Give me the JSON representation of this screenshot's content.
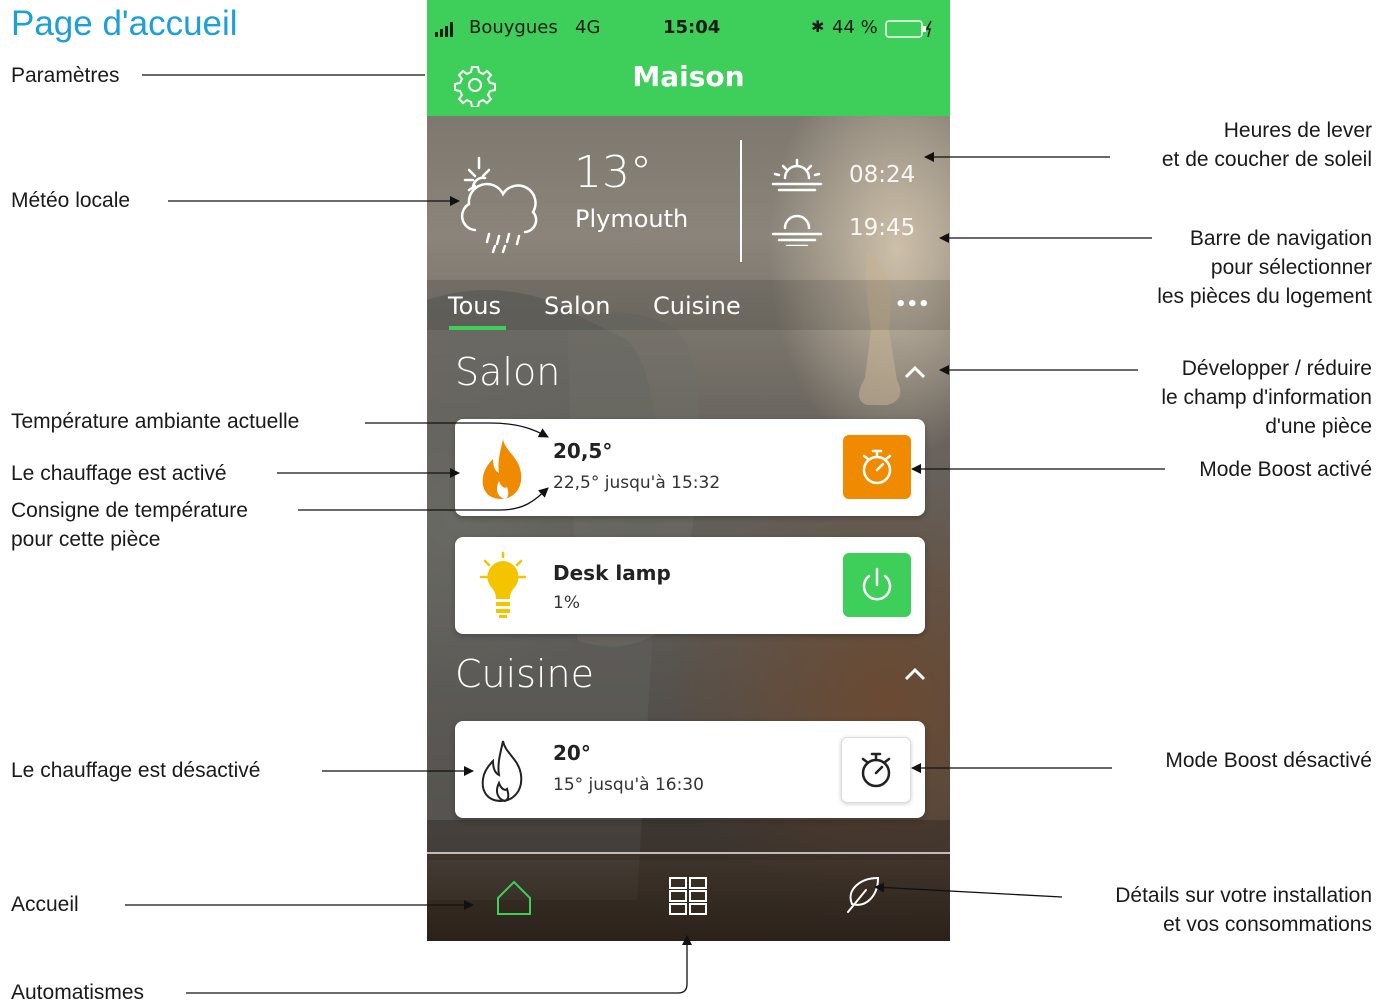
{
  "page_title": "Page d'accueil",
  "status_bar": {
    "carrier": "Bouygues",
    "network": "4G",
    "time": "15:04",
    "battery": "44 %"
  },
  "header": {
    "title": "Maison"
  },
  "weather": {
    "temperature": "13°",
    "city": "Plymouth",
    "sunrise": "08:24",
    "sunset": "19:45"
  },
  "tabs": [
    {
      "label": "Tous",
      "active": true
    },
    {
      "label": "Salon",
      "active": false
    },
    {
      "label": "Cuisine",
      "active": false
    }
  ],
  "more_label": "•••",
  "rooms": [
    {
      "name": "Salon",
      "devices": [
        {
          "main": "20,5°",
          "sub": "22,5° jusqu'à 15:32",
          "icon": "flame-icon",
          "boost": "timer-icon",
          "boost_active": true
        },
        {
          "main": "Desk lamp",
          "sub": "1%",
          "icon": "lightbulb-icon",
          "power": "power-icon",
          "on": true
        }
      ]
    },
    {
      "name": "Cuisine",
      "devices": [
        {
          "main": "20°",
          "sub": "15° jusqu'à 16:30",
          "icon": "flame-outline-icon",
          "boost": "timer-icon",
          "boost_active": false
        }
      ]
    }
  ],
  "bottom_nav": [
    "home-icon",
    "grid-icon",
    "leaf-icon"
  ],
  "annotations": {
    "parametres": "Paramètres",
    "meteo": "Météo locale",
    "sun_line1": "Heures de lever",
    "sun_line2": "et de coucher de soleil",
    "nav_line1": "Barre de navigation",
    "nav_line2": "pour sélectionner",
    "nav_line3": "les pièces du logement",
    "expand_line1": "Développer / réduire",
    "expand_line2": "le champ d'information",
    "expand_line3": "d'une pièce",
    "temp_actuelle": "Température ambiante actuelle",
    "chauffage_active": "Le chauffage est activé",
    "consigne_line1": "Consigne de température",
    "consigne_line2": "pour cette pièce",
    "boost_active": "Mode Boost activé",
    "chauffage_desactive": "Le chauffage est désactivé",
    "boost_desactive": "Mode Boost désactivé",
    "accueil": "Accueil",
    "details_line1": "Détails sur votre installation",
    "details_line2": "et vos consommations",
    "automatismes": "Automatismes"
  },
  "colors": {
    "brand_green": "#3ecf5a",
    "boost_orange": "#f08a00",
    "title_blue": "#1d9fd8",
    "lamp_yellow": "#f5c400"
  }
}
